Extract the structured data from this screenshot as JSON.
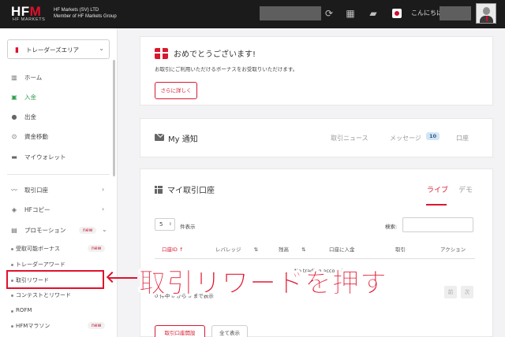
{
  "topbar": {
    "logo_text": "HF",
    "logo_m": "M",
    "logo_sub": "HF MARKETS",
    "company_line1": "HF Markets (SV) LTD",
    "company_line2": "Member of HF Markets Group",
    "greeting": "こんにちは",
    "icons": [
      "refresh-icon",
      "apps-grid-icon",
      "chat-icon",
      "japan-flag-icon",
      "avatar"
    ]
  },
  "sidebar": {
    "area_selector": "トレーダーズエリア",
    "nav": [
      {
        "label": "ホーム",
        "icon": "chart-icon"
      },
      {
        "label": "入金",
        "icon": "deposit-icon"
      },
      {
        "label": "出金",
        "icon": "withdraw-icon"
      },
      {
        "label": "資金移動",
        "icon": "transfer-icon"
      },
      {
        "label": "マイウォレット",
        "icon": "wallet-icon"
      }
    ],
    "nav2": [
      {
        "label": "取引口座",
        "icon": "trading-chart-icon"
      },
      {
        "label": "HFコピー",
        "icon": "layers-icon"
      },
      {
        "label": "プロモーション",
        "icon": "gift-icon",
        "badge": "new"
      }
    ],
    "promo_items": [
      {
        "label": "受取可能ボーナス",
        "badge": "new"
      },
      {
        "label": "トレーダーアワード"
      },
      {
        "label": "取引リワード"
      },
      {
        "label": "コンテストとリワード"
      },
      {
        "label": "ROFM"
      },
      {
        "label": "HFMマラソン",
        "badge": "new"
      }
    ]
  },
  "congrats": {
    "title": "おめでとうございます!",
    "text": "お取引にご利用いただけるボーナスをお受取りいただけます。",
    "button": "さらに詳しく"
  },
  "notifications": {
    "title": "My 通知",
    "tabs": [
      "取引ニュース",
      "メッセージ",
      "口座"
    ],
    "message_count": "10"
  },
  "accounts": {
    "title": "マイ取引口座",
    "tabs": [
      "ライブ",
      "デモ"
    ],
    "show_value": "5",
    "show_suffix": "件表示",
    "search_label": "検索:",
    "columns": [
      "口座ID",
      "レバレッジ",
      "残高",
      "口座に入金",
      "取引",
      "アクション"
    ],
    "empty_text": "No trading account",
    "info": "0 件中 0 から 0 まで表示",
    "prev": "前",
    "next": "次",
    "open_button": "取引口座開設",
    "show_all_button": "全て表示"
  },
  "annotation": {
    "arrow": "←",
    "text": "取引リワードを押す"
  },
  "colors": {
    "brand_red": "#e0112b",
    "active_green": "#2e9e4f",
    "topbar": "#1b1b1b"
  }
}
